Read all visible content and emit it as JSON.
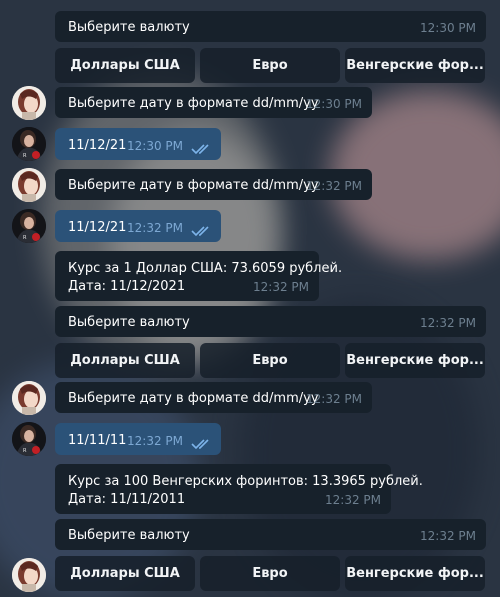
{
  "prompts": {
    "currency": "Выберите валюту",
    "date": "Выберите дату в формате dd/mm/yy"
  },
  "keyboard": {
    "usd": "Доллары США",
    "eur": "Евро",
    "huf": "Венгерские фор..."
  },
  "messages": {
    "m1_time": "12:30 PM",
    "m2_time": "12:30 PM",
    "m3_text": "11/12/21",
    "m3_time": "12:30 PM",
    "m4_time": "12:32 PM",
    "m5_text": "11/12/21",
    "m5_time": "12:32 PM",
    "m6_line1": "Курс за 1 Доллар США: 73.6059 рублей.",
    "m6_line2": "Дата: 11/12/2021",
    "m6_time": "12:32 PM",
    "m7_time": "12:32 PM",
    "m8_time": "12:32 PM",
    "m9_text": "11/11/11",
    "m9_time": "12:32 PM",
    "m10_line1": "Курс за 100 Венгерских форинтов: 13.3965 рублей.",
    "m10_line2": "Дата: 11/11/2011",
    "m10_time": "12:32 PM",
    "m11_time": "12:32 PM"
  },
  "icon_names": [
    "bot-avatar",
    "user-avatar",
    "double-check-icon"
  ],
  "colors": {
    "incoming_bubble": "#17212b",
    "outgoing_bubble": "#2b5278",
    "time_incoming": "#6d7f8f",
    "time_outgoing": "#7da8d3"
  }
}
